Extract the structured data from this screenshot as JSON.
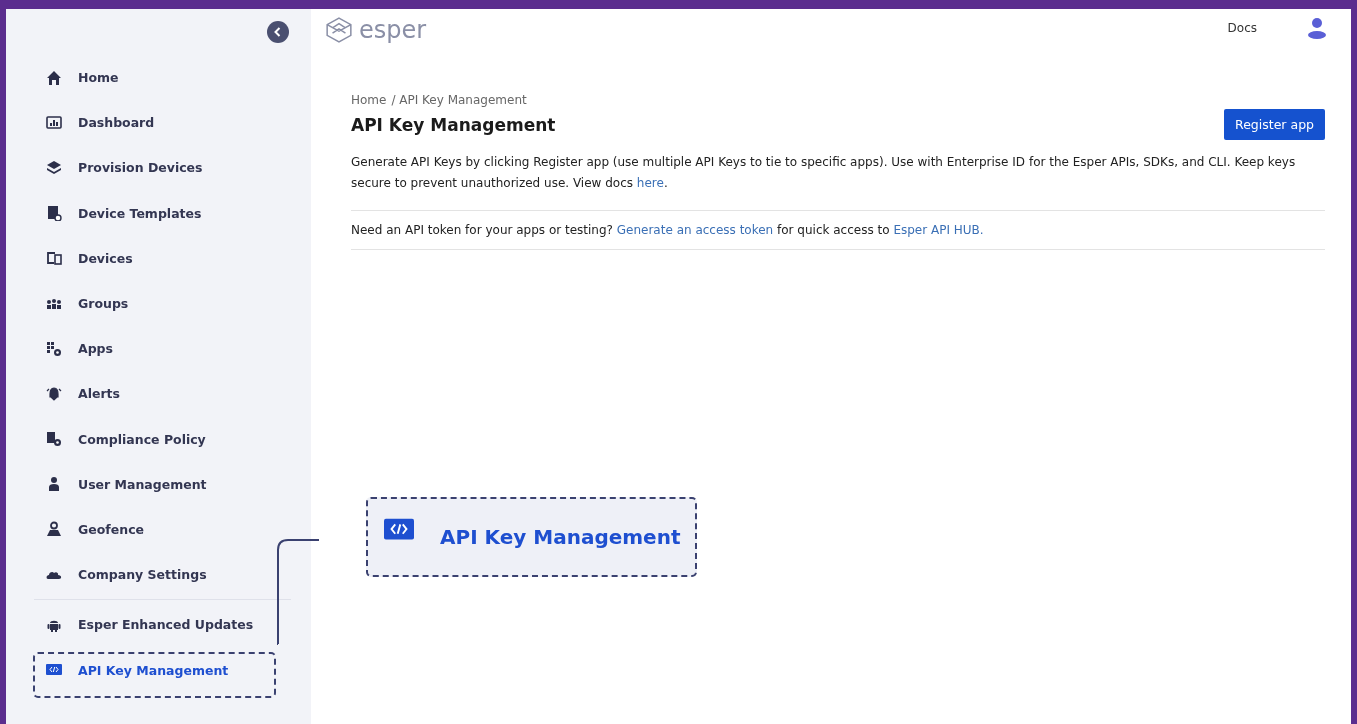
{
  "sidebar": {
    "items": [
      {
        "label": "Home",
        "selected": false
      },
      {
        "label": "Dashboard",
        "selected": false
      },
      {
        "label": "Provision Devices",
        "selected": false
      },
      {
        "label": "Device Templates",
        "selected": false
      },
      {
        "label": "Devices",
        "selected": false
      },
      {
        "label": "Groups",
        "selected": false
      },
      {
        "label": "Apps",
        "selected": false
      },
      {
        "label": "Alerts",
        "selected": false
      },
      {
        "label": "Compliance Policy",
        "selected": false
      },
      {
        "label": "User Management",
        "selected": false
      },
      {
        "label": "Geofence",
        "selected": false
      },
      {
        "label": "Company Settings",
        "selected": false
      }
    ],
    "bottom_items": [
      {
        "label": "Esper Enhanced Updates",
        "selected": false
      },
      {
        "label": "API Key Management",
        "selected": true
      }
    ]
  },
  "header": {
    "logo": "esper",
    "docs": "Docs"
  },
  "breadcrumb": [
    "Home",
    "/ API Key Management"
  ],
  "page_title": "API Key Management",
  "register_button": "Register app",
  "description": {
    "text": "Generate API Keys by clicking Register app (use multiple API Keys to tie to specific apps). Use with Enterprise ID for the Esper APIs, SDKs, and CLI. Keep keys secure to prevent unauthorized use. View docs",
    "link": "here",
    "end": "."
  },
  "token_note": {
    "before": "Need an API token for your apps or testing?",
    "link1": "Generate an access token",
    "middle": "for quick access to",
    "link2": "Esper API HUB."
  },
  "callout": {
    "label": "API Key Management"
  }
}
